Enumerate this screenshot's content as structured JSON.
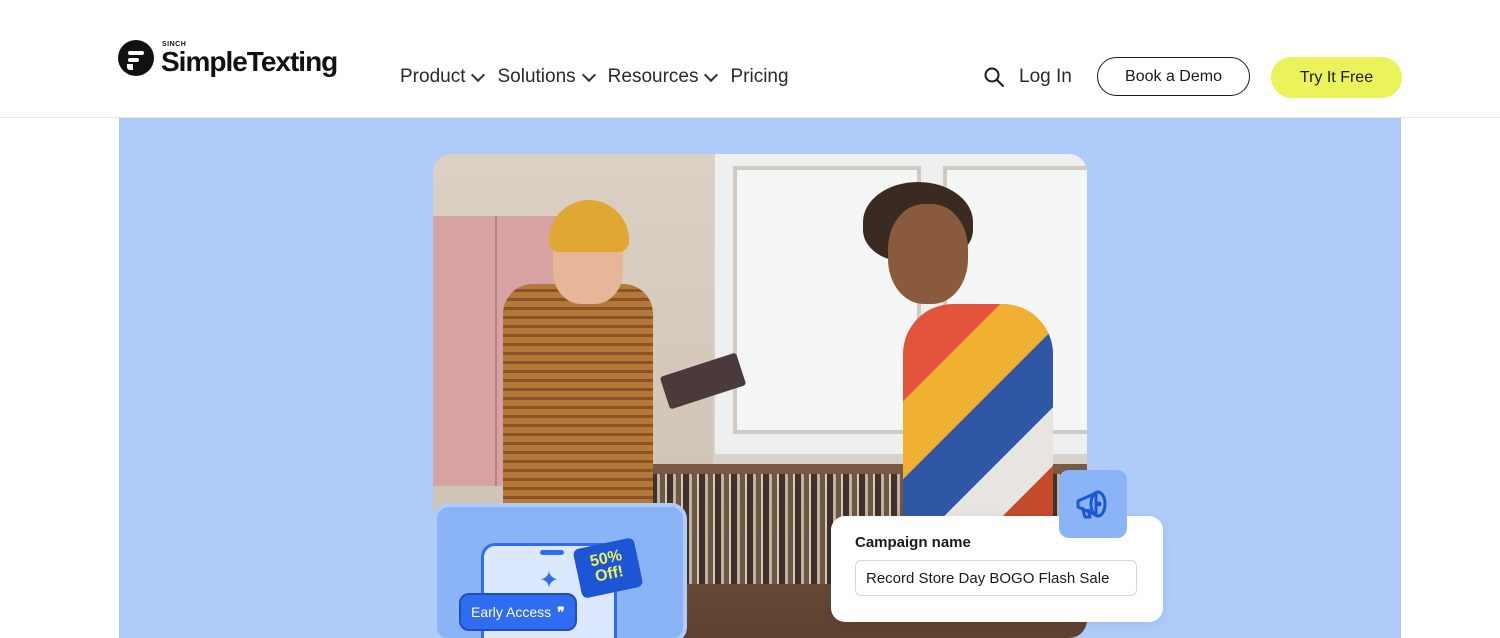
{
  "brand": {
    "sinch": "SINCH",
    "name": "SimpleTexting"
  },
  "nav": {
    "items": [
      {
        "label": "Product"
      },
      {
        "label": "Solutions"
      },
      {
        "label": "Resources"
      },
      {
        "label": "Pricing"
      }
    ]
  },
  "header": {
    "login_label": "Log In",
    "demo_label": "Book a Demo",
    "try_label": "Try It Free"
  },
  "hero": {
    "phone_badge": "50% Off!",
    "early_access": "Early Access",
    "campaign_label": "Campaign name",
    "campaign_value": "Record Store Day BOGO Flash Sale"
  },
  "colors": {
    "hero_bg": "#aecbfa",
    "accent_yellow": "#eaf45a",
    "accent_blue": "#2f6cf0"
  }
}
